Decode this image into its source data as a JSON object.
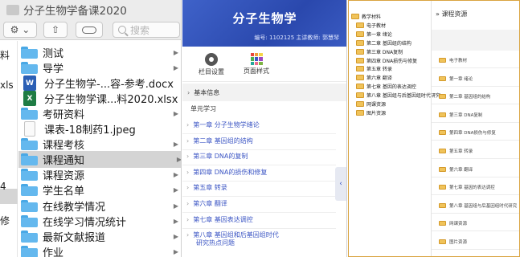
{
  "finder": {
    "title": "分子生物学备课2020",
    "toolbar": {
      "gear_glyph": "⚙︎ ⌄",
      "share_glyph": "⇧",
      "search_placeholder": "搜索"
    },
    "left_column_fragments": [
      "料",
      "xls",
      "4",
      "修"
    ],
    "items": [
      {
        "label": "测试",
        "icon": "folder-icon",
        "has_arrow": true
      },
      {
        "label": "导学",
        "icon": "folder-icon",
        "has_arrow": true
      },
      {
        "label": "分子生物学-...容-参考.docx",
        "icon": "word-doc-icon",
        "has_arrow": false
      },
      {
        "label": "分子生物学课...料2020.xlsx",
        "icon": "excel-doc-icon",
        "has_arrow": false
      },
      {
        "label": "考研资料",
        "icon": "folder-icon",
        "has_arrow": true
      },
      {
        "label": "课表-18制药1.jpeg",
        "icon": "image-file-icon",
        "has_arrow": false
      },
      {
        "label": "课程考核",
        "icon": "folder-icon",
        "has_arrow": true
      },
      {
        "label": "课程通知",
        "icon": "folder-icon",
        "has_arrow": true,
        "selected": true
      },
      {
        "label": "课程资源",
        "icon": "folder-icon",
        "has_arrow": true
      },
      {
        "label": "学生名单",
        "icon": "folder-icon",
        "has_arrow": true
      },
      {
        "label": "在线教学情况",
        "icon": "folder-icon",
        "has_arrow": true
      },
      {
        "label": "在线学习情况统计",
        "icon": "folder-icon",
        "has_arrow": true
      },
      {
        "label": "最新文献报道",
        "icon": "folder-icon",
        "has_arrow": true
      },
      {
        "label": "作业",
        "icon": "folder-icon",
        "has_arrow": true
      }
    ],
    "arrow_glyph": "▶"
  },
  "portal": {
    "course_title": "分子生物学",
    "info": "编号: 1102125    主讲教师: 郭慧琴",
    "tools": [
      {
        "label": "栏目设置",
        "icon": "gear-icon"
      },
      {
        "label": "页面样式",
        "icon": "grid-icon"
      }
    ],
    "grid_colors": [
      "#e8453c",
      "#f29c38",
      "#f5d547",
      "#4caf50",
      "#3c56c4",
      "#9c46c2",
      "#26a69a",
      "#ef6c8e",
      "#7cb342"
    ],
    "basic_info": "基本信息",
    "unit_section": "单元学习",
    "chevron_right": "›",
    "chevron_down": "∨",
    "collapse_glyph": "‹",
    "chapters": [
      "第一章 分子生物学绪论",
      "第二章 基因组的结构",
      "第三章 DNA的复制",
      "第四章 DNA的损伤和修复",
      "第五章 转录",
      "第六章 翻译",
      "第七章 基因表达调控",
      "第八章 基因组和后基因组时代"
    ],
    "chapter8_tail": "研究热点问题",
    "accent": "#3c56c4"
  },
  "resources": {
    "tree": [
      {
        "label": "教学材料",
        "level": 0
      },
      {
        "label": "电子教材",
        "level": 1
      },
      {
        "label": "第一章 绪论",
        "level": 1
      },
      {
        "label": "第二章 基因组的结构",
        "level": 1
      },
      {
        "label": "第三章 DNA复制",
        "level": 1
      },
      {
        "label": "第四章 DNA损伤与修复",
        "level": 1
      },
      {
        "label": "第五章 转录",
        "level": 1
      },
      {
        "label": "第六章 翻译",
        "level": 1
      },
      {
        "label": "第七章 基因的表达调控",
        "level": 1
      },
      {
        "label": "第八章 基因组与后基因组时代研究",
        "level": 1
      },
      {
        "label": "网课资源",
        "level": 1
      },
      {
        "label": "图片资源",
        "level": 1
      }
    ],
    "header": "» 课程资源",
    "list": [
      "电子教材",
      "第一章 绪论",
      "第二章 基因组的结构",
      "第三章 DNA复制",
      "第四章 DNA损伤与修复",
      "第五章 转录",
      "第六章 翻译",
      "第七章 基因的表达调控",
      "第八章 基因组与后基因组时代研究",
      "网课资源",
      "图片资源"
    ]
  }
}
